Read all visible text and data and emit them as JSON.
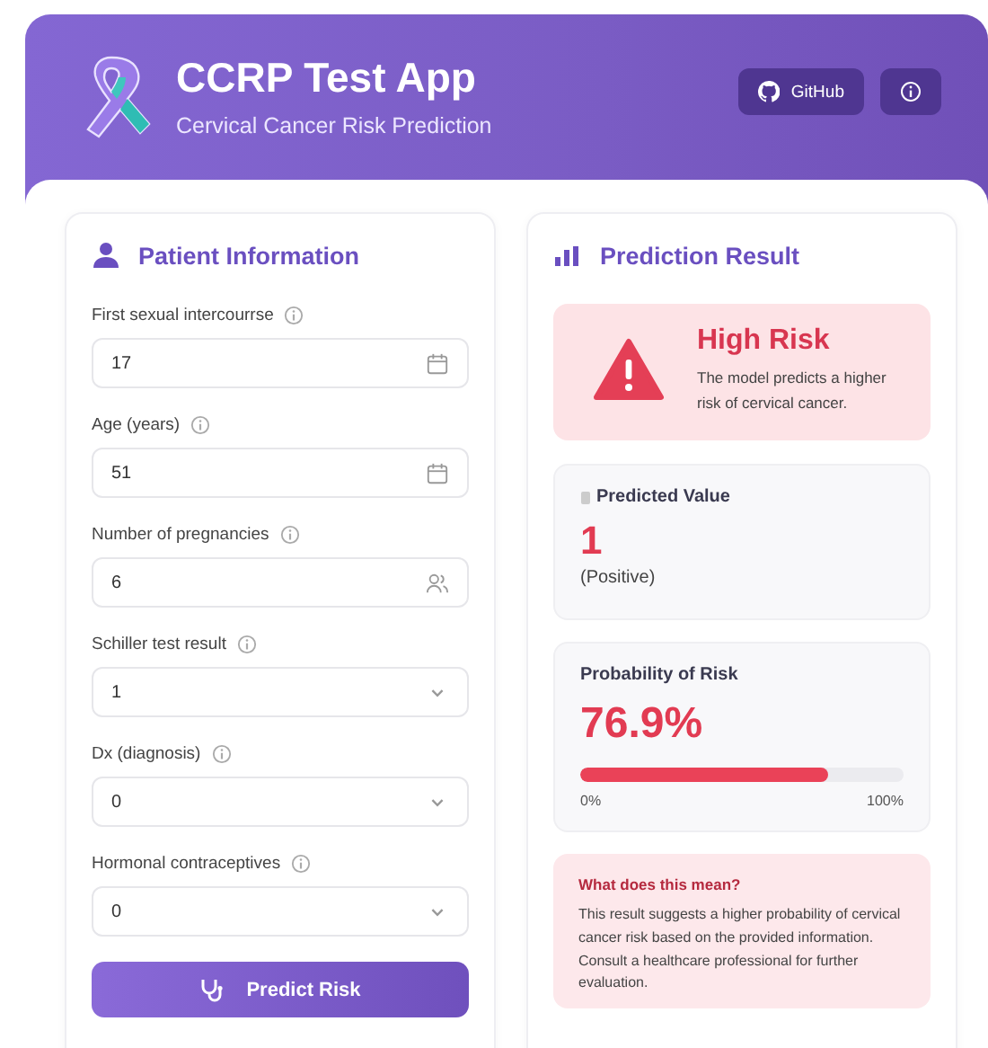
{
  "header": {
    "title": "CCRP Test App",
    "subtitle": "Cervical Cancer Risk Prediction",
    "buttons": [
      {
        "kind": "github",
        "label": "GitHub"
      },
      {
        "kind": "info"
      }
    ]
  },
  "patient": {
    "title": "Patient Information",
    "fields": [
      {
        "kind": "date",
        "label": "First sexual intercourrse",
        "value": "17"
      },
      {
        "kind": "date",
        "label": "Age (years)",
        "value": "51"
      },
      {
        "kind": "count",
        "label": "Number of pregnancies",
        "value": "6"
      },
      {
        "kind": "select",
        "label": "Schiller test result",
        "value": "1"
      },
      {
        "kind": "select",
        "label": "Dx (diagnosis)",
        "value": "0"
      },
      {
        "kind": "select",
        "label": "Hormonal contraceptives",
        "value": "0"
      }
    ],
    "submit": "Predict Risk"
  },
  "result": {
    "title": "Prediction Result",
    "alert": {
      "kind": "high",
      "title": "High Risk",
      "text": "The model predicts a higher risk of cervical cancer."
    },
    "predicted": {
      "label": "Predicted Value",
      "value": "1",
      "note": "(Positive)"
    },
    "probability": {
      "label": "Probability of Risk",
      "value": "76.9%",
      "level": 0.769,
      "min": "0%",
      "max": "100%"
    },
    "meaning": {
      "title": "What does this mean?",
      "text": "This result suggests a higher probability of cervical cancer risk based on the provided information. Consult a healthcare professional for further evaluation."
    }
  }
}
